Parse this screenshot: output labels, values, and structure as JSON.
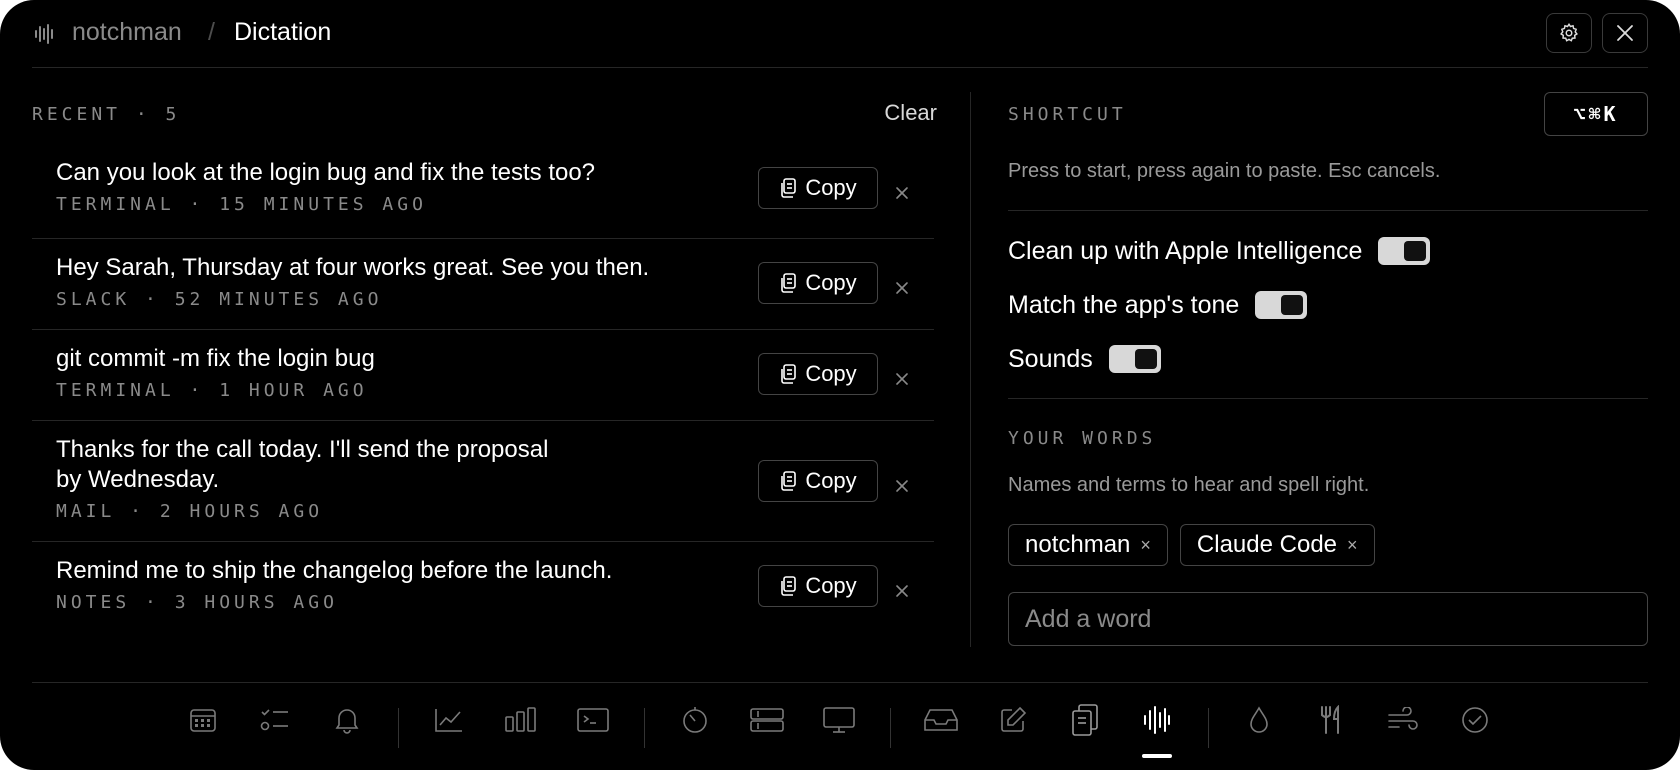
{
  "header": {
    "app_name": "notchman",
    "separator": "/",
    "page_title": "Dictation",
    "settings_icon": "gear-icon",
    "close_icon": "close-icon"
  },
  "recent": {
    "label": "RECENT · 5",
    "clear_label": "Clear",
    "copy_label": "Copy",
    "items": [
      {
        "text": "Can you look at the login bug and fix the tests too?",
        "meta": "TERMINAL · 15 MINUTES AGO"
      },
      {
        "text": "Hey Sarah, Thursday at four works great. See you then.",
        "meta": "SLACK · 52 MINUTES AGO"
      },
      {
        "text": "git commit -m fix the login bug",
        "meta": "TERMINAL · 1 HOUR AGO"
      },
      {
        "text_line1": "Thanks for the call today. I'll send the proposal",
        "text_line2": "by Wednesday.",
        "meta": "MAIL · 2 HOURS AGO"
      },
      {
        "text": "Remind me to ship the changelog before the launch.",
        "meta": "NOTES · 3 HOURS AGO"
      }
    ]
  },
  "shortcut": {
    "label": "SHORTCUT",
    "keys": "⌥⌘K",
    "hint": "Press to start, press again to paste. Esc cancels."
  },
  "settings": {
    "toggles": [
      {
        "label": "Clean up with Apple Intelligence",
        "on": true
      },
      {
        "label": "Match the app's tone",
        "on": true
      },
      {
        "label": "Sounds",
        "on": true
      }
    ]
  },
  "words": {
    "label": "YOUR WORDS",
    "hint": "Names and terms to hear and spell right.",
    "chips": [
      "notchman",
      "Claude Code"
    ],
    "chip_remove": "×",
    "input_placeholder": "Add a word"
  },
  "dock": {
    "icons": [
      "calendar-icon",
      "checklist-icon",
      "bell-icon",
      "line-chart-icon",
      "bar-chart-icon",
      "terminal-icon",
      "timer-icon",
      "server-icon",
      "monitor-icon",
      "inbox-icon",
      "edit-icon",
      "clipboard-icon",
      "waveform-icon",
      "drop-icon",
      "fork-knife-icon",
      "wind-icon",
      "check-circle-icon"
    ],
    "active": "waveform-icon"
  },
  "colors": {
    "background": "#000000",
    "text": "#ffffff",
    "muted": "#8a8a8a",
    "border": "#444444",
    "toggle_on": "#d8d8d8"
  }
}
